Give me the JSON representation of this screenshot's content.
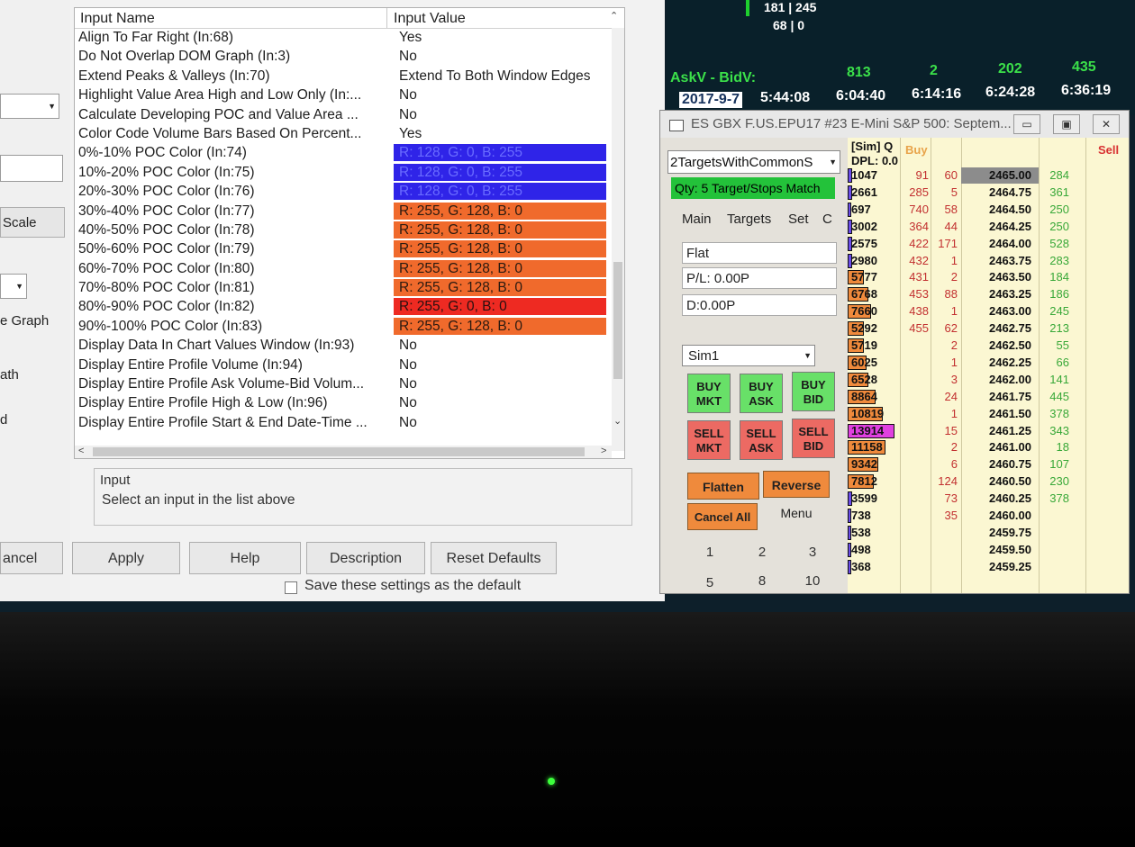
{
  "dialog": {
    "headers": {
      "name": "Input Name",
      "value": "Input Value"
    },
    "rows": [
      {
        "name": "Align To Far Right  (In:68)",
        "value": "Yes",
        "bg": "#ffffff",
        "fg": "#1e1e1e"
      },
      {
        "name": "Do Not Overlap DOM Graph  (In:3)",
        "value": "No",
        "bg": "#ffffff",
        "fg": "#1e1e1e"
      },
      {
        "name": "Extend Peaks & Valleys  (In:70)",
        "value": "Extend To Both Window Edges",
        "bg": "#ffffff",
        "fg": "#1e1e1e"
      },
      {
        "name": "Highlight Value Area High and Low Only  (In:...",
        "value": "No",
        "bg": "#ffffff",
        "fg": "#1e1e1e"
      },
      {
        "name": "Calculate Developing POC and Value Area ...",
        "value": "No",
        "bg": "#ffffff",
        "fg": "#1e1e1e"
      },
      {
        "name": "Color Code Volume Bars Based On Percent...",
        "value": "Yes",
        "bg": "#ffffff",
        "fg": "#1e1e1e"
      },
      {
        "name": "0%-10% POC Color  (In:74)",
        "value": "R: 128, G: 0, B: 255",
        "bg": "#2f24e8",
        "fg": "#6a6cff"
      },
      {
        "name": "10%-20% POC Color  (In:75)",
        "value": "R: 128, G: 0, B: 255",
        "bg": "#2f24e8",
        "fg": "#6a6cff"
      },
      {
        "name": "20%-30% POC Color  (In:76)",
        "value": "R: 128, G: 0, B: 255",
        "bg": "#2f24e8",
        "fg": "#6a6cff"
      },
      {
        "name": "30%-40% POC Color  (In:77)",
        "value": "R: 255, G: 128, B: 0",
        "bg": "#f06a2c",
        "fg": "#2a1a10"
      },
      {
        "name": "40%-50% POC Color  (In:78)",
        "value": "R: 255, G: 128, B: 0",
        "bg": "#f06a2c",
        "fg": "#2a1a10"
      },
      {
        "name": "50%-60% POC Color  (In:79)",
        "value": "R: 255, G: 128, B: 0",
        "bg": "#f06a2c",
        "fg": "#2a1a10"
      },
      {
        "name": "60%-70% POC Color  (In:80)",
        "value": "R: 255, G: 128, B: 0",
        "bg": "#f06a2c",
        "fg": "#2a1a10"
      },
      {
        "name": "70%-80% POC Color  (In:81)",
        "value": "R: 255, G: 128, B: 0",
        "bg": "#f06a2c",
        "fg": "#2a1a10"
      },
      {
        "name": "80%-90% POC Color  (In:82)",
        "value": "R: 255, G: 0, B: 0",
        "bg": "#ee2a22",
        "fg": "#2a1010"
      },
      {
        "name": "90%-100% POC Color  (In:83)",
        "value": "R: 255, G: 128, B: 0",
        "bg": "#f06a2c",
        "fg": "#2a1a10"
      },
      {
        "name": "Display Data In Chart Values Window  (In:93)",
        "value": "No",
        "bg": "#ffffff",
        "fg": "#1e1e1e"
      },
      {
        "name": "Display Entire Profile Volume  (In:94)",
        "value": "No",
        "bg": "#ffffff",
        "fg": "#1e1e1e"
      },
      {
        "name": "Display Entire Profile Ask Volume-Bid Volum...",
        "value": "No",
        "bg": "#ffffff",
        "fg": "#1e1e1e"
      },
      {
        "name": "Display Entire Profile High & Low  (In:96)",
        "value": "No",
        "bg": "#ffffff",
        "fg": "#1e1e1e"
      },
      {
        "name": "Display Entire Profile Start & End Date-Time ...",
        "value": "No",
        "bg": "#ffffff",
        "fg": "#1e1e1e"
      }
    ],
    "info_title": "Input",
    "info_text": "Select an input in the list above",
    "buttons": {
      "cancel": "ancel",
      "apply": "Apply",
      "help": "Help",
      "description": "Description",
      "reset": "Reset Defaults"
    },
    "save_default": "Save these settings as the default",
    "strip": {
      "scale": "Scale",
      "graph": "e Graph",
      "path": "ath",
      "d": "d"
    }
  },
  "ticker": {
    "top1": "181 | 245",
    "top2": "68 | 0",
    "askv_label": "AskV - BidV:",
    "askv_values": [
      "813",
      "2",
      "202",
      "435"
    ],
    "date": "2017-9-7",
    "times": [
      "5:44:08",
      "6:04:40",
      "6:14:16",
      "6:24:28",
      "6:36:19"
    ]
  },
  "dom": {
    "title": "ES GBX  F.US.EPU17  #23  E-Mini S&P 500: Septem...",
    "strategy": "2TargetsWithCommonS",
    "qty": "Qty: 5 Target/Stops Match",
    "tabs": [
      "Main",
      "Targets",
      "Set",
      "C"
    ],
    "position": "Flat",
    "pl": "P/L: 0.00P",
    "d": "D:0.00P",
    "account": "Sim1",
    "buy_mkt": [
      "BUY",
      "MKT"
    ],
    "buy_ask": [
      "BUY",
      "ASK"
    ],
    "buy_bid": [
      "BUY",
      "BID"
    ],
    "sell_mkt": [
      "SELL",
      "MKT"
    ],
    "sell_ask": [
      "SELL",
      "ASK"
    ],
    "sell_bid": [
      "SELL",
      "BID"
    ],
    "flatten": "Flatten",
    "reverse": "Reverse",
    "cancel_all": "Cancel All",
    "menu": "Menu",
    "qty_buttons": [
      "1",
      "2",
      "3",
      "5",
      "8",
      "10"
    ],
    "ladder_headers": {
      "sim": "[Sim]  Q",
      "dpl": "DPL: 0.0",
      "buy": "Buy",
      "sell": "Sell"
    },
    "colors": {
      "buy_header": "#e8a34a",
      "sell_header": "#d83232",
      "accent_orange": "#ef8a3c",
      "magenta": "#e040e0"
    },
    "ladder": [
      {
        "vol": "1047",
        "bid": "91",
        "ask": "60",
        "price": "2465.00",
        "sell": "284",
        "bar": 0.1,
        "magenta": false
      },
      {
        "vol": "2661",
        "bid": "285",
        "ask": "5",
        "price": "2464.75",
        "sell": "361",
        "bar": 0.1,
        "magenta": false
      },
      {
        "vol": "697",
        "bid": "740",
        "ask": "58",
        "price": "2464.50",
        "sell": "250",
        "bar": 0.05,
        "magenta": false
      },
      {
        "vol": "3002",
        "bid": "364",
        "ask": "44",
        "price": "2464.25",
        "sell": "250",
        "bar": 0.1,
        "magenta": false
      },
      {
        "vol": "2575",
        "bid": "422",
        "ask": "171",
        "price": "2464.00",
        "sell": "528",
        "bar": 0.1,
        "magenta": false
      },
      {
        "vol": "2980",
        "bid": "432",
        "ask": "1",
        "price": "2463.75",
        "sell": "283",
        "bar": 0.1,
        "magenta": false
      },
      {
        "vol": "5777",
        "bid": "431",
        "ask": "2",
        "price": "2463.50",
        "sell": "184",
        "bar": 0.35,
        "magenta": false
      },
      {
        "vol": "6768",
        "bid": "453",
        "ask": "88",
        "price": "2463.25",
        "sell": "186",
        "bar": 0.45,
        "magenta": false
      },
      {
        "vol": "7660",
        "bid": "438",
        "ask": "1",
        "price": "2463.00",
        "sell": "245",
        "bar": 0.5,
        "magenta": false
      },
      {
        "vol": "5292",
        "bid": "455",
        "ask": "62",
        "price": "2462.75",
        "sell": "213",
        "bar": 0.35,
        "magenta": false
      },
      {
        "vol": "5719",
        "bid": "",
        "ask": "2",
        "price": "2462.50",
        "sell": "55",
        "bar": 0.35,
        "magenta": false
      },
      {
        "vol": "6025",
        "bid": "",
        "ask": "1",
        "price": "2462.25",
        "sell": "66",
        "bar": 0.4,
        "magenta": false
      },
      {
        "vol": "6528",
        "bid": "",
        "ask": "3",
        "price": "2462.00",
        "sell": "141",
        "bar": 0.45,
        "magenta": false
      },
      {
        "vol": "8864",
        "bid": "",
        "ask": "24",
        "price": "2461.75",
        "sell": "445",
        "bar": 0.6,
        "magenta": false
      },
      {
        "vol": "10819",
        "bid": "",
        "ask": "1",
        "price": "2461.50",
        "sell": "378",
        "bar": 0.75,
        "magenta": false
      },
      {
        "vol": "13914",
        "bid": "",
        "ask": "15",
        "price": "2461.25",
        "sell": "343",
        "bar": 1.0,
        "magenta": true
      },
      {
        "vol": "11158",
        "bid": "",
        "ask": "2",
        "price": "2461.00",
        "sell": "18",
        "bar": 0.8,
        "magenta": false
      },
      {
        "vol": "9342",
        "bid": "",
        "ask": "6",
        "price": "2460.75",
        "sell": "107",
        "bar": 0.65,
        "magenta": false
      },
      {
        "vol": "7812",
        "bid": "",
        "ask": "124",
        "price": "2460.50",
        "sell": "230",
        "bar": 0.55,
        "magenta": false
      },
      {
        "vol": "3599",
        "bid": "",
        "ask": "73",
        "price": "2460.25",
        "sell": "378",
        "bar": 0.1,
        "magenta": false
      },
      {
        "vol": "738",
        "bid": "",
        "ask": "35",
        "price": "2460.00",
        "sell": "",
        "bar": 0.05,
        "magenta": false
      },
      {
        "vol": "538",
        "bid": "",
        "ask": "",
        "price": "2459.75",
        "sell": "",
        "bar": 0.05,
        "magenta": false
      },
      {
        "vol": "498",
        "bid": "",
        "ask": "",
        "price": "2459.50",
        "sell": "",
        "bar": 0.05,
        "magenta": false
      },
      {
        "vol": "368",
        "bid": "",
        "ask": "",
        "price": "2459.25",
        "sell": "",
        "bar": 0.05,
        "magenta": false
      }
    ]
  }
}
